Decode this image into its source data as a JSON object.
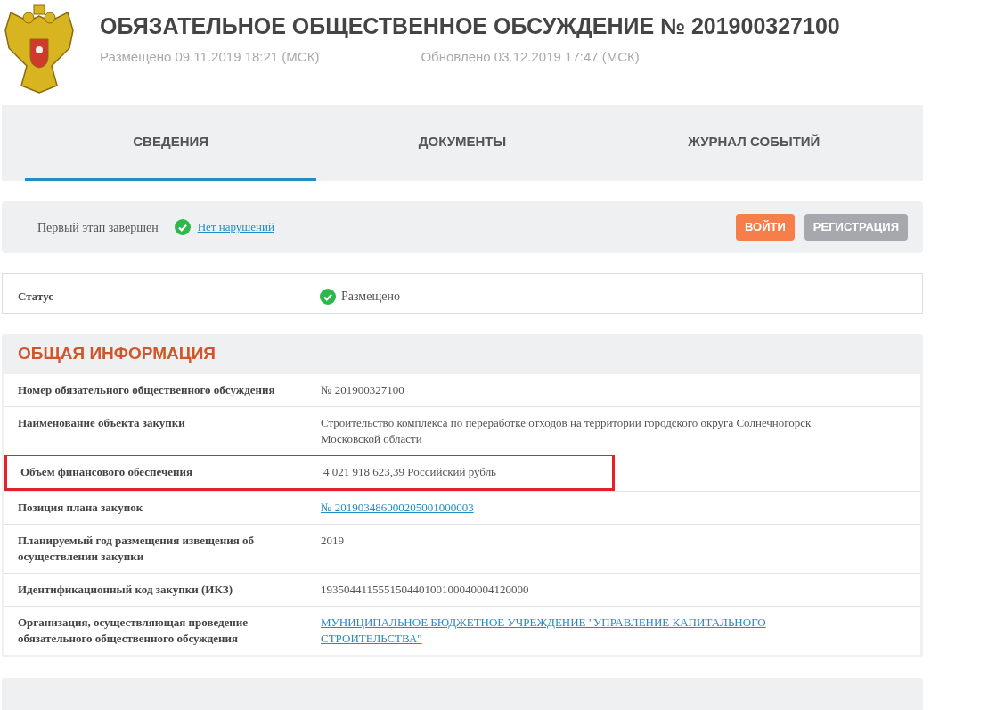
{
  "header": {
    "title": "ОБЯЗАТЕЛЬНОЕ ОБЩЕСТВЕННОЕ ОБСУЖДЕНИЕ № 201900327100",
    "posted": "Размещено 09.11.2019 18:21 (МСК)",
    "updated": "Обновлено 03.12.2019 17:47 (МСК)"
  },
  "tabs": [
    {
      "label": "СВЕДЕНИЯ",
      "selected": true
    },
    {
      "label": "ДОКУМЕНТЫ",
      "selected": false
    },
    {
      "label": "ЖУРНАЛ СОБЫТИЙ",
      "selected": false
    }
  ],
  "stage_bar": {
    "stage": "Первый этап завершен",
    "violations_link": "Нет нарушений",
    "buttons": [
      {
        "label": "ВОЙТИ",
        "kind": "primary"
      },
      {
        "label": "РЕГИСТРАЦИЯ",
        "kind": "secondary"
      }
    ]
  },
  "status": {
    "label": "Статус",
    "value": "Размещено"
  },
  "general_info": {
    "title": "ОБЩАЯ ИНФОРМАЦИЯ",
    "rows": [
      {
        "label": "Номер обязательного общественного обсуждения",
        "value": "№ 201900327100",
        "kind": "text",
        "highlighted": false
      },
      {
        "label": "Наименование объекта закупки",
        "value": "Строительство комплекса по переработке отходов на территории городского округа Солнечногорск Московской области",
        "kind": "text",
        "highlighted": false
      },
      {
        "label": "Объем финансового обеспечения",
        "value": "4 021 918 623,39 Российский рубль",
        "kind": "text",
        "highlighted": true
      },
      {
        "label": "Позиция плана закупок",
        "value": "№ 201903486000205001000003",
        "kind": "link",
        "highlighted": false
      },
      {
        "label": "Планируемый год размещения извещения об осуществлении закупки",
        "value": "2019",
        "kind": "text",
        "highlighted": false
      },
      {
        "label": "Идентификационный код закупки (ИКЗ)",
        "value": "193504411555150440100100040004120000",
        "kind": "text",
        "highlighted": false
      },
      {
        "label": "Организация, осуществляющая проведение обязательного общественного обсуждения",
        "value": "МУНИЦИПАЛЬНОЕ БЮДЖЕТНОЕ УЧРЕЖДЕНИЕ \"УПРАВЛЕНИЕ КАПИТАЛЬНОГО СТРОИТЕЛЬСТВА\"",
        "kind": "link",
        "highlighted": false
      }
    ]
  }
}
